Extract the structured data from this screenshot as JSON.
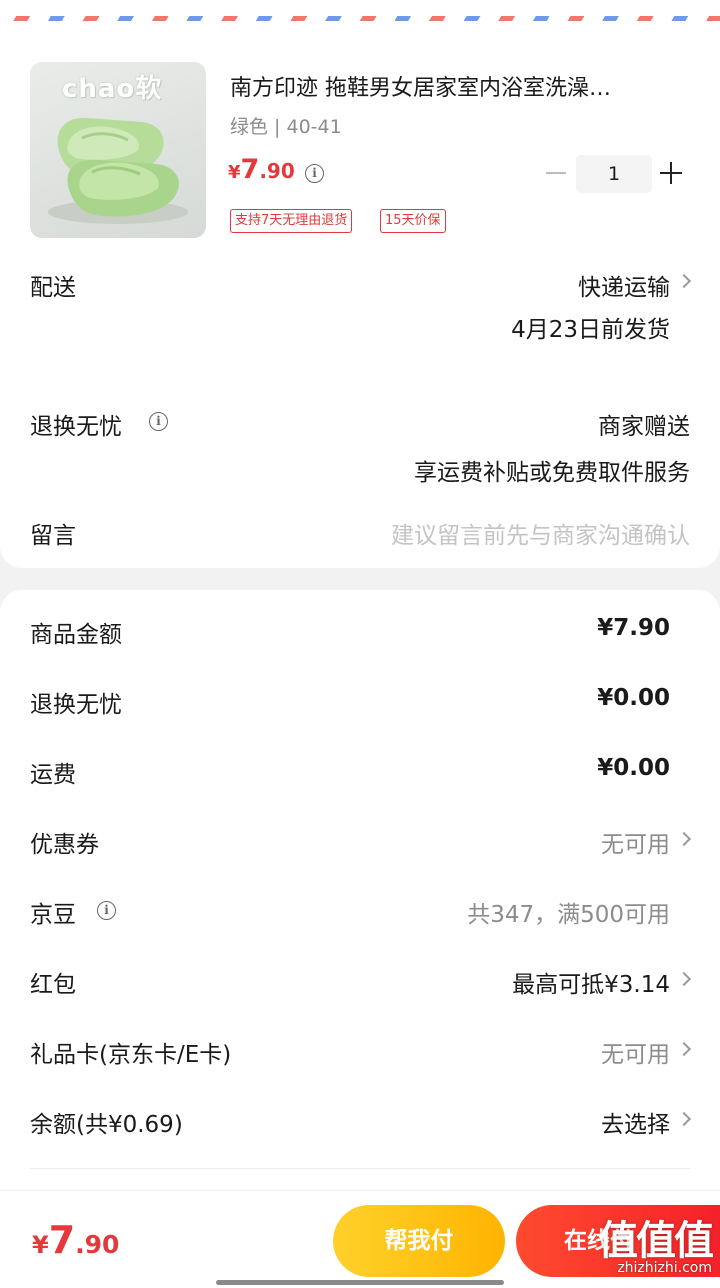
{
  "colors": {
    "accent": "#e4393c",
    "help_btn": "#ffc20e",
    "pay_btn": "#f4212a"
  },
  "product": {
    "brand_overlay": "chao软",
    "title": "南方印迹 拖鞋男女居家室内浴室洗澡…",
    "spec": "绿色 | 40-41",
    "price": {
      "yen": "¥",
      "int": "7",
      "dec": ".90"
    },
    "quantity": "1",
    "tags": [
      "支持7天无理由退货",
      "15天价保"
    ]
  },
  "delivery": {
    "label": "配送",
    "method": "快递运输",
    "date": "4月23日前发货"
  },
  "return_worry": {
    "label": "退换无忧",
    "value": "商家赠送",
    "note": "享运费补贴或免费取件服务"
  },
  "message": {
    "label": "留言",
    "placeholder": "建议留言前先与商家沟通确认"
  },
  "summary": {
    "goods": {
      "label": "商品金额",
      "value": "¥7.90"
    },
    "return": {
      "label": "退换无忧",
      "value": "¥0.00"
    },
    "freight": {
      "label": "运费",
      "value": "¥0.00"
    },
    "coupon": {
      "label": "优惠券",
      "value": "无可用"
    },
    "jingdou": {
      "label": "京豆",
      "value": "共347，满500可用"
    },
    "redpacket": {
      "label": "红包",
      "value": "最高可抵¥3.14"
    },
    "giftcard": {
      "label": "礼品卡(京东卡/E卡)",
      "value": "无可用"
    },
    "balance": {
      "label": "余额(共¥0.69)",
      "value": "去选择"
    }
  },
  "bottom": {
    "total": {
      "yen": "¥",
      "int": "7",
      "dec": ".90"
    },
    "help_pay": "帮我付",
    "pay": "在线付"
  },
  "watermark": {
    "glyphs": "值值值",
    "url": "zhizhizhi.com"
  }
}
